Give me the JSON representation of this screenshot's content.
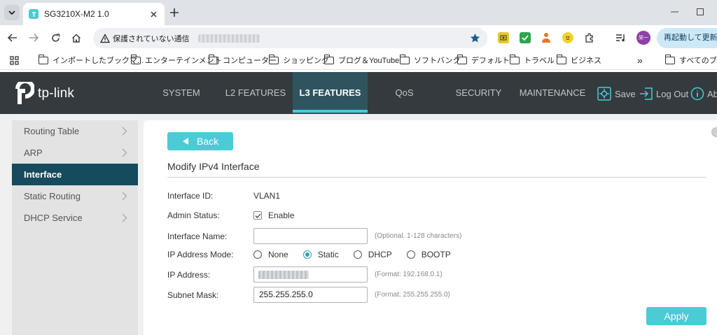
{
  "browser": {
    "tab_title": "SG3210X-M2 1.0",
    "security_warning": "保護されていない通信",
    "profile_initials": "栄一",
    "relaunch_label": "再起動して更新する",
    "bookmarks": [
      "インポートしたブックマ...",
      "エンターテインメント",
      "コンピューター",
      "ショッピング",
      "ブログ＆YouTube",
      "ソフトバンク",
      "デフォルト",
      "トラベル",
      "ビジネス"
    ],
    "bookmarks_overflow": "»",
    "all_bookmarks": "すべてのブック"
  },
  "app": {
    "logo": "tp-link",
    "nav": [
      "SYSTEM",
      "L2 FEATURES",
      "L3 FEATURES",
      "QoS",
      "SECURITY",
      "MAINTENANCE"
    ],
    "active_nav": "L3 FEATURES",
    "save_label": "Save",
    "logout_label": "Log Out",
    "about_label": "Ab",
    "accent_color": "#4acbd6",
    "header_color": "#343a3e",
    "sidebar": [
      {
        "label": "Routing Table",
        "active": false
      },
      {
        "label": "ARP",
        "active": false
      },
      {
        "label": "Interface",
        "active": true
      },
      {
        "label": "Static Routing",
        "active": false
      },
      {
        "label": "DHCP Service",
        "active": false
      }
    ]
  },
  "form": {
    "back_label": "Back",
    "title": "Modify IPv4 Interface",
    "interface_id_label": "Interface ID:",
    "interface_id_value": "VLAN1",
    "admin_status_label": "Admin Status:",
    "admin_status_option": "Enable",
    "admin_status_checked": true,
    "interface_name_label": "Interface Name:",
    "interface_name_value": "",
    "interface_name_hint": "(Optional. 1-128 characters)",
    "ip_mode_label": "IP Address Mode:",
    "ip_modes": [
      "None",
      "Static",
      "DHCP",
      "BOOTP"
    ],
    "ip_mode_selected": "Static",
    "ip_address_label": "IP Address:",
    "ip_address_hint": "(Format: 192.168.0.1)",
    "subnet_mask_label": "Subnet Mask:",
    "subnet_mask_value": "255.255.255.0",
    "subnet_mask_hint": "(Format: 255.255.255.0)",
    "apply_label": "Apply"
  }
}
